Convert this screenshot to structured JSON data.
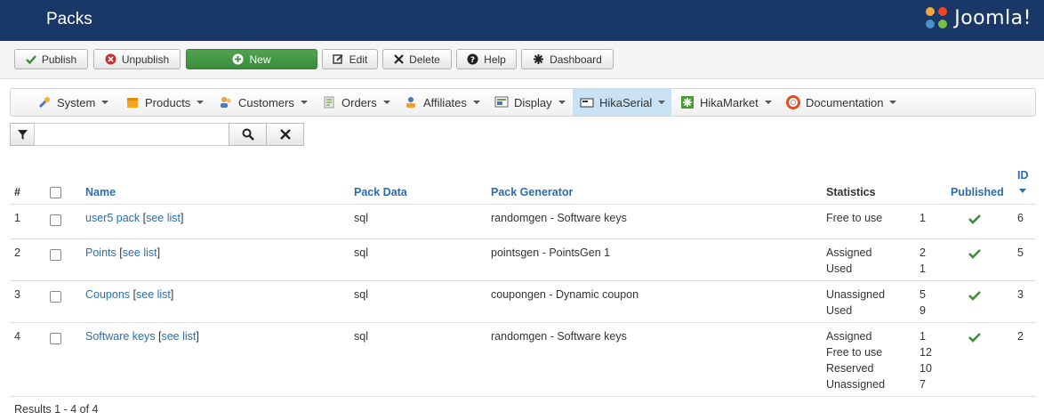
{
  "header": {
    "title": "Packs",
    "brand": "Joomla!"
  },
  "toolbar": {
    "publish": "Publish",
    "unpublish": "Unpublish",
    "new": "New",
    "edit": "Edit",
    "delete": "Delete",
    "help": "Help",
    "dashboard": "Dashboard"
  },
  "menu": [
    {
      "label": "System",
      "icon": "tools-icon"
    },
    {
      "label": "Products",
      "icon": "box-icon"
    },
    {
      "label": "Customers",
      "icon": "users-icon"
    },
    {
      "label": "Orders",
      "icon": "orders-icon"
    },
    {
      "label": "Affiliates",
      "icon": "affiliate-icon"
    },
    {
      "label": "Display",
      "icon": "display-icon"
    },
    {
      "label": "HikaSerial",
      "icon": "serial-icon",
      "active": true
    },
    {
      "label": "HikaMarket",
      "icon": "market-icon"
    },
    {
      "label": "Documentation",
      "icon": "lifebuoy-icon"
    }
  ],
  "filter": {
    "value": "",
    "placeholder": ""
  },
  "table": {
    "headers": {
      "num": "#",
      "name": "Name",
      "pack_data": "Pack Data",
      "pack_generator": "Pack Generator",
      "statistics": "Statistics",
      "published": "Published",
      "id": "ID"
    },
    "rows": [
      {
        "num": "1",
        "name": "user5 pack",
        "see_list": "see list",
        "pack_data": "sql",
        "generator": "randomgen - Software keys",
        "stats": [
          {
            "label": "Free to use",
            "value": "1"
          }
        ],
        "id": "6"
      },
      {
        "num": "2",
        "name": "Points",
        "see_list": "see list",
        "pack_data": "sql",
        "generator": "pointsgen - PointsGen 1",
        "stats": [
          {
            "label": "Assigned",
            "value": "2"
          },
          {
            "label": "Used",
            "value": "1"
          }
        ],
        "id": "5"
      },
      {
        "num": "3",
        "name": "Coupons",
        "see_list": "see list",
        "pack_data": "sql",
        "generator": "coupongen - Dynamic coupon",
        "stats": [
          {
            "label": "Unassigned",
            "value": "5"
          },
          {
            "label": "Used",
            "value": "9"
          }
        ],
        "id": "3"
      },
      {
        "num": "4",
        "name": "Software keys",
        "see_list": "see list",
        "pack_data": "sql",
        "generator": "randomgen - Software keys",
        "stats": [
          {
            "label": "Assigned",
            "value": "1"
          },
          {
            "label": "Free to use",
            "value": "12"
          },
          {
            "label": "Reserved",
            "value": "10"
          },
          {
            "label": "Unassigned",
            "value": "7"
          }
        ],
        "id": "2"
      }
    ]
  },
  "footer": {
    "results": "Results 1 - 4 of 4"
  },
  "colors": {
    "header_bg": "#1a3867",
    "link": "#2a6dad",
    "new_button": "#4aa04a",
    "published_check": "#3c8d3c",
    "active_menu": "#c8e1f3"
  }
}
